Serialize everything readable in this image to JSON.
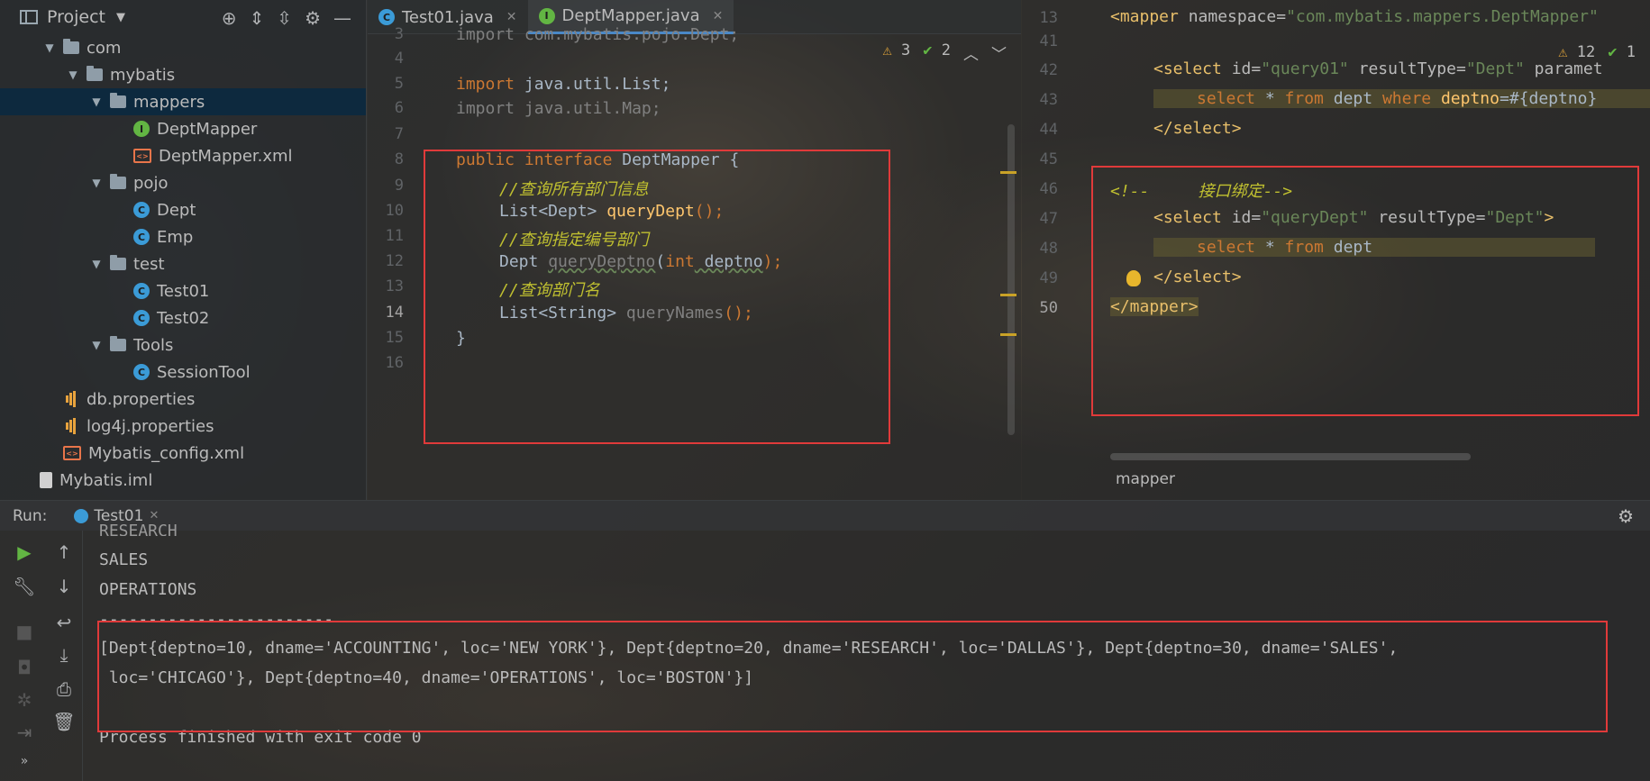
{
  "project": {
    "title": "Project",
    "tree": [
      {
        "label": "com",
        "type": "folder",
        "open": true
      },
      {
        "label": "mybatis",
        "type": "folder",
        "open": true
      },
      {
        "label": "mappers",
        "type": "folder",
        "open": true,
        "selected": true
      },
      {
        "label": "DeptMapper",
        "type": "interface"
      },
      {
        "label": "DeptMapper.xml",
        "type": "xml"
      },
      {
        "label": "pojo",
        "type": "folder",
        "open": true
      },
      {
        "label": "Dept",
        "type": "class"
      },
      {
        "label": "Emp",
        "type": "class"
      },
      {
        "label": "test",
        "type": "folder",
        "open": true
      },
      {
        "label": "Test01",
        "type": "class"
      },
      {
        "label": "Test02",
        "type": "class"
      },
      {
        "label": "Tools",
        "type": "folder",
        "open": true
      },
      {
        "label": "SessionTool",
        "type": "class"
      },
      {
        "label": "db.properties",
        "type": "props"
      },
      {
        "label": "log4j.properties",
        "type": "props"
      },
      {
        "label": "Mybatis_config.xml",
        "type": "xml"
      },
      {
        "label": "Mybatis.iml",
        "type": "iml"
      }
    ]
  },
  "tabs": [
    {
      "label": "Test01.java",
      "icon": "C",
      "active": false
    },
    {
      "label": "DeptMapper.java",
      "icon": "I",
      "active": true
    }
  ],
  "java_editor": {
    "warnings": "3",
    "checks": "2",
    "line_numbers": [
      "3",
      "4",
      "5",
      "6",
      "7",
      "8",
      "9",
      "10",
      "11",
      "12",
      "13",
      "14",
      "15",
      "16"
    ],
    "lines": {
      "l3": "import com.mybatis.pojo.Dept;",
      "l5_kw": "import",
      "l5_rest": " java.util.List;",
      "l6": "import java.util.Map;",
      "l8_kw1": "public",
      "l8_kw2": "interface",
      "l8_rest": " DeptMapper {",
      "l9": "//查询所有部门信息",
      "l10_type": "List<Dept> ",
      "l10_fn": "queryDept",
      "l10_end": "();",
      "l11": "//查询指定编号部门",
      "l12_type": "Dept ",
      "l12_fn": "queryDeptno",
      "l12_paren": "(",
      "l12_kw": "int",
      "l12_param": " deptno",
      "l12_end": ");",
      "l13": "//查询部门名",
      "l14_type": "List<String> ",
      "l14_fn": "queryNames",
      "l14_end": "();",
      "l15": "}"
    }
  },
  "xml_editor": {
    "warnings": "12",
    "checks": "1",
    "line_numbers": [
      "13",
      "41",
      "42",
      "43",
      "44",
      "45",
      "46",
      "47",
      "48",
      "49",
      "50"
    ],
    "lines": {
      "l13_tag": "<mapper ",
      "l13_attr": "namespace=",
      "l13_val": "\"com.mybatis.mappers.DeptMapper\"",
      "l42_tag": "<select ",
      "l42_attr1": "id=",
      "l42_val1": "\"query01\"",
      "l42_attr2": " resultType=",
      "l42_val2": "\"Dept\"",
      "l42_attr3": " paramet",
      "l43_kw1": "select",
      "l43_t1": " * ",
      "l43_kw2": "from",
      "l43_t2": " dept ",
      "l43_kw3": "where",
      "l43_fn": " deptno",
      "l43_t3": "=#{deptno}",
      "l44": "</select>",
      "l46": "<!--     接口绑定-->",
      "l47_tag": "<select ",
      "l47_attr1": "id=",
      "l47_val1": "\"queryDept\"",
      "l47_attr2": " resultType=",
      "l47_val2": "\"Dept\"",
      "l47_close": ">",
      "l48_kw1": "select",
      "l48_t1": " * ",
      "l48_kw2": "from",
      "l48_t2": " dept",
      "l49": "</select>",
      "l50": "</mapper>"
    },
    "breadcrumb": "mapper"
  },
  "run": {
    "label": "Run:",
    "tab": "Test01",
    "output": {
      "cut": "RESEARCH",
      "l1": "SALES",
      "l2": "OPERATIONS",
      "l3": "------------------------",
      "l4": "[Dept{deptno=10, dname='ACCOUNTING', loc='NEW YORK'}, Dept{deptno=20, dname='RESEARCH', loc='DALLAS'}, Dept{deptno=30, dname='SALES',",
      "l5": " loc='CHICAGO'}, Dept{deptno=40, dname='OPERATIONS', loc='BOSTON'}]",
      "l6": "Process finished with exit code 0"
    }
  }
}
